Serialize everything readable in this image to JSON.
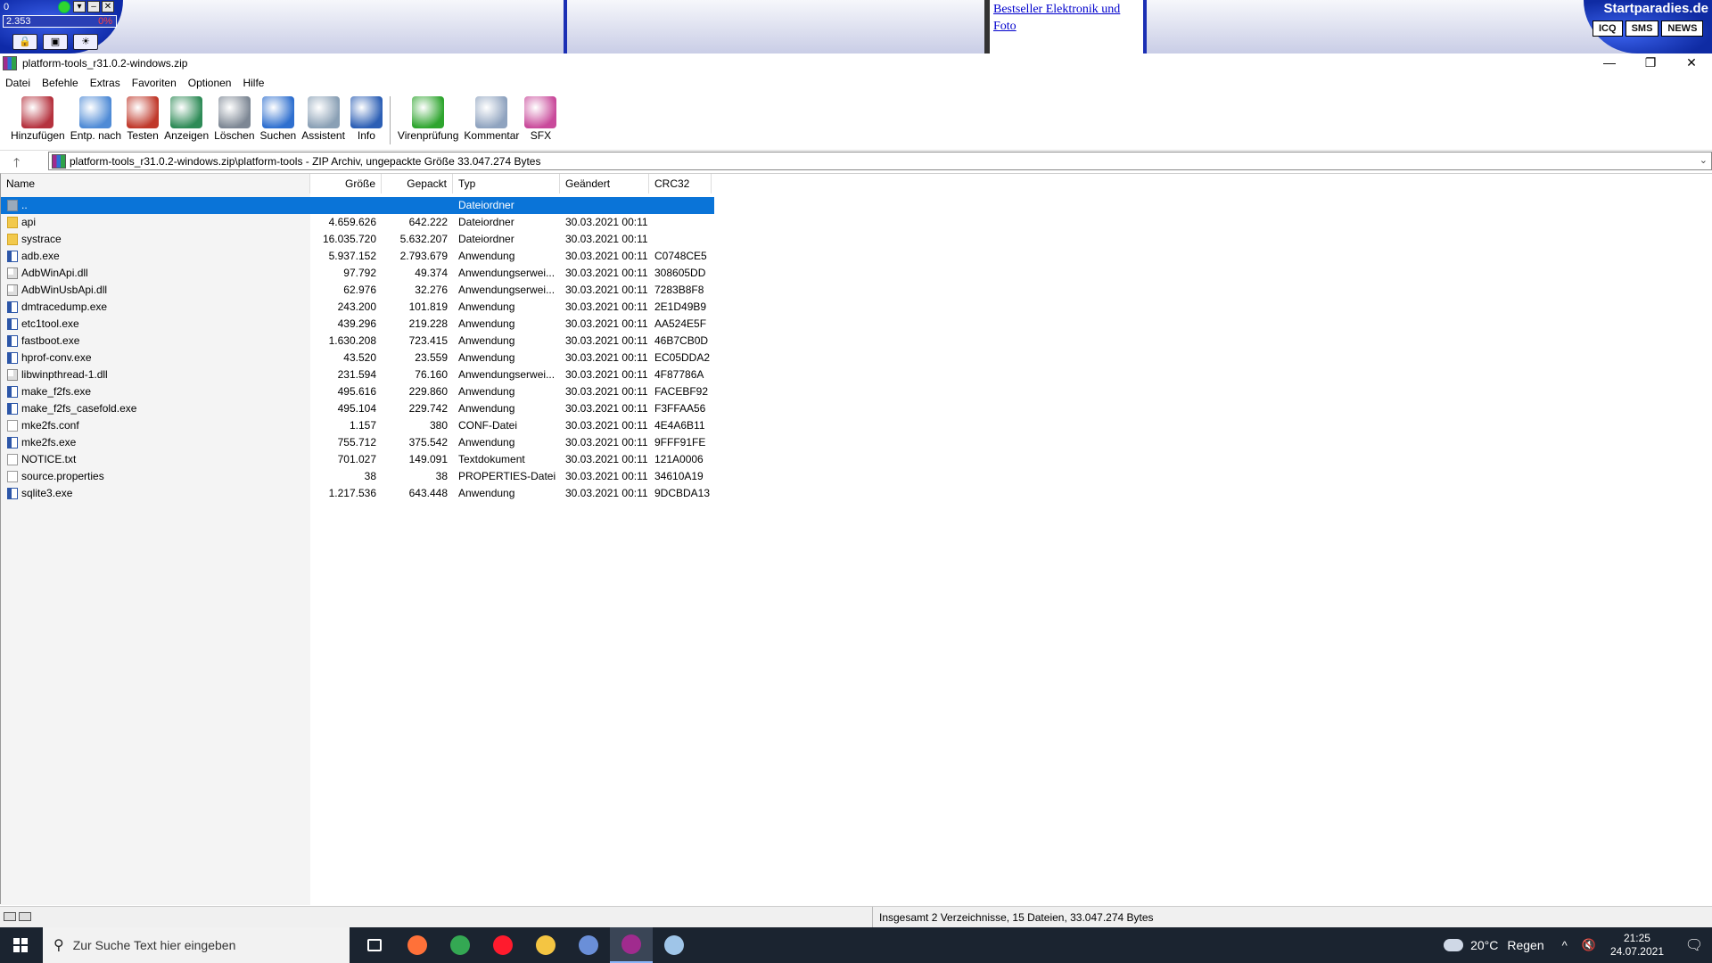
{
  "top_widget": {
    "label": "0",
    "counter": "2.353",
    "percent": "0%"
  },
  "ad": {
    "text": "Bestseller Elektronik und Foto"
  },
  "startparadies": {
    "brand": "Startparadies.de",
    "buttons": [
      "ICQ",
      "SMS",
      "NEWS"
    ]
  },
  "window": {
    "title": "platform-tools_r31.0.2-windows.zip",
    "minimize": "—",
    "restore": "❐",
    "close": "✕"
  },
  "menu": [
    "Datei",
    "Befehle",
    "Extras",
    "Favoriten",
    "Optionen",
    "Hilfe"
  ],
  "toolbar": [
    {
      "label": "Hinzufügen",
      "icon": "add-archive-icon",
      "color": "#b5323e"
    },
    {
      "label": "Entp. nach",
      "icon": "extract-folder-icon",
      "color": "#4f8bd6"
    },
    {
      "label": "Testen",
      "icon": "test-clipboard-icon",
      "color": "#c0392b"
    },
    {
      "label": "Anzeigen",
      "icon": "view-book-icon",
      "color": "#2e8b57"
    },
    {
      "label": "Löschen",
      "icon": "trash-icon",
      "color": "#7d8794"
    },
    {
      "label": "Suchen",
      "icon": "search-magnifier-icon",
      "color": "#2e6fcf"
    },
    {
      "label": "Assistent",
      "icon": "wizard-wand-icon",
      "color": "#8aa0b5"
    },
    {
      "label": "Info",
      "icon": "info-icon",
      "color": "#2c5fb5"
    },
    {
      "label": "Virenprüfung",
      "icon": "virus-scan-icon",
      "color": "#2ea52e"
    },
    {
      "label": "Kommentar",
      "icon": "comment-icon",
      "color": "#8fa3bf"
    },
    {
      "label": "SFX",
      "icon": "sfx-archive-icon",
      "color": "#c94a9b"
    }
  ],
  "path": {
    "up_label": "🡑",
    "text": "platform-tools_r31.0.2-windows.zip\\platform-tools - ZIP Archiv, ungepackte Größe 33.047.274 Bytes",
    "dropdown": "⌄"
  },
  "columns": {
    "name": "Name",
    "size": "Größe",
    "packed": "Gepackt",
    "type": "Typ",
    "modified": "Geändert",
    "crc": "CRC32"
  },
  "files": [
    {
      "name": "..",
      "size": "",
      "packed": "",
      "type": "Dateiordner",
      "modified": "",
      "crc": "",
      "kind": "up",
      "selected": true
    },
    {
      "name": "api",
      "size": "4.659.626",
      "packed": "642.222",
      "type": "Dateiordner",
      "modified": "30.03.2021 00:11",
      "crc": "",
      "kind": "folder"
    },
    {
      "name": "systrace",
      "size": "16.035.720",
      "packed": "5.632.207",
      "type": "Dateiordner",
      "modified": "30.03.2021 00:11",
      "crc": "",
      "kind": "folder"
    },
    {
      "name": "adb.exe",
      "size": "5.937.152",
      "packed": "2.793.679",
      "type": "Anwendung",
      "modified": "30.03.2021 00:11",
      "crc": "C0748CE5",
      "kind": "exe"
    },
    {
      "name": "AdbWinApi.dll",
      "size": "97.792",
      "packed": "49.374",
      "type": "Anwendungserwei...",
      "modified": "30.03.2021 00:11",
      "crc": "308605DD",
      "kind": "dll"
    },
    {
      "name": "AdbWinUsbApi.dll",
      "size": "62.976",
      "packed": "32.276",
      "type": "Anwendungserwei...",
      "modified": "30.03.2021 00:11",
      "crc": "7283B8F8",
      "kind": "dll"
    },
    {
      "name": "dmtracedump.exe",
      "size": "243.200",
      "packed": "101.819",
      "type": "Anwendung",
      "modified": "30.03.2021 00:11",
      "crc": "2E1D49B9",
      "kind": "exe"
    },
    {
      "name": "etc1tool.exe",
      "size": "439.296",
      "packed": "219.228",
      "type": "Anwendung",
      "modified": "30.03.2021 00:11",
      "crc": "AA524E5F",
      "kind": "exe"
    },
    {
      "name": "fastboot.exe",
      "size": "1.630.208",
      "packed": "723.415",
      "type": "Anwendung",
      "modified": "30.03.2021 00:11",
      "crc": "46B7CB0D",
      "kind": "exe"
    },
    {
      "name": "hprof-conv.exe",
      "size": "43.520",
      "packed": "23.559",
      "type": "Anwendung",
      "modified": "30.03.2021 00:11",
      "crc": "EC05DDA2",
      "kind": "exe"
    },
    {
      "name": "libwinpthread-1.dll",
      "size": "231.594",
      "packed": "76.160",
      "type": "Anwendungserwei...",
      "modified": "30.03.2021 00:11",
      "crc": "4F87786A",
      "kind": "dll"
    },
    {
      "name": "make_f2fs.exe",
      "size": "495.616",
      "packed": "229.860",
      "type": "Anwendung",
      "modified": "30.03.2021 00:11",
      "crc": "FACEBF92",
      "kind": "exe"
    },
    {
      "name": "make_f2fs_casefold.exe",
      "size": "495.104",
      "packed": "229.742",
      "type": "Anwendung",
      "modified": "30.03.2021 00:11",
      "crc": "F3FFAA56",
      "kind": "exe"
    },
    {
      "name": "mke2fs.conf",
      "size": "1.157",
      "packed": "380",
      "type": "CONF-Datei",
      "modified": "30.03.2021 00:11",
      "crc": "4E4A6B11",
      "kind": "txt"
    },
    {
      "name": "mke2fs.exe",
      "size": "755.712",
      "packed": "375.542",
      "type": "Anwendung",
      "modified": "30.03.2021 00:11",
      "crc": "9FFF91FE",
      "kind": "exe"
    },
    {
      "name": "NOTICE.txt",
      "size": "701.027",
      "packed": "149.091",
      "type": "Textdokument",
      "modified": "30.03.2021 00:11",
      "crc": "121A0006",
      "kind": "txt"
    },
    {
      "name": "source.properties",
      "size": "38",
      "packed": "38",
      "type": "PROPERTIES-Datei",
      "modified": "30.03.2021 00:11",
      "crc": "34610A19",
      "kind": "txt"
    },
    {
      "name": "sqlite3.exe",
      "size": "1.217.536",
      "packed": "643.448",
      "type": "Anwendung",
      "modified": "30.03.2021 00:11",
      "crc": "9DCBDA13",
      "kind": "exe"
    }
  ],
  "status": {
    "text": "Insgesamt 2 Verzeichnisse, 15 Dateien, 33.047.274 Bytes"
  },
  "taskbar": {
    "search_placeholder": "Zur Suche Text hier eingeben",
    "apps": [
      {
        "name": "task-view",
        "color": "#ffffff"
      },
      {
        "name": "firefox",
        "color": "#ff7139"
      },
      {
        "name": "chrome",
        "color": "#34a853"
      },
      {
        "name": "opera",
        "color": "#ff1b2d"
      },
      {
        "name": "file-explorer",
        "color": "#f4c542"
      },
      {
        "name": "app-diamond",
        "color": "#6a8fd8"
      },
      {
        "name": "winrar",
        "color": "#a02b8e",
        "active": true
      },
      {
        "name": "paint-app",
        "color": "#9fc5e8"
      }
    ],
    "weather_temp": "20°C",
    "weather_desc": "Regen",
    "time": "21:25",
    "date": "24.07.2021"
  }
}
